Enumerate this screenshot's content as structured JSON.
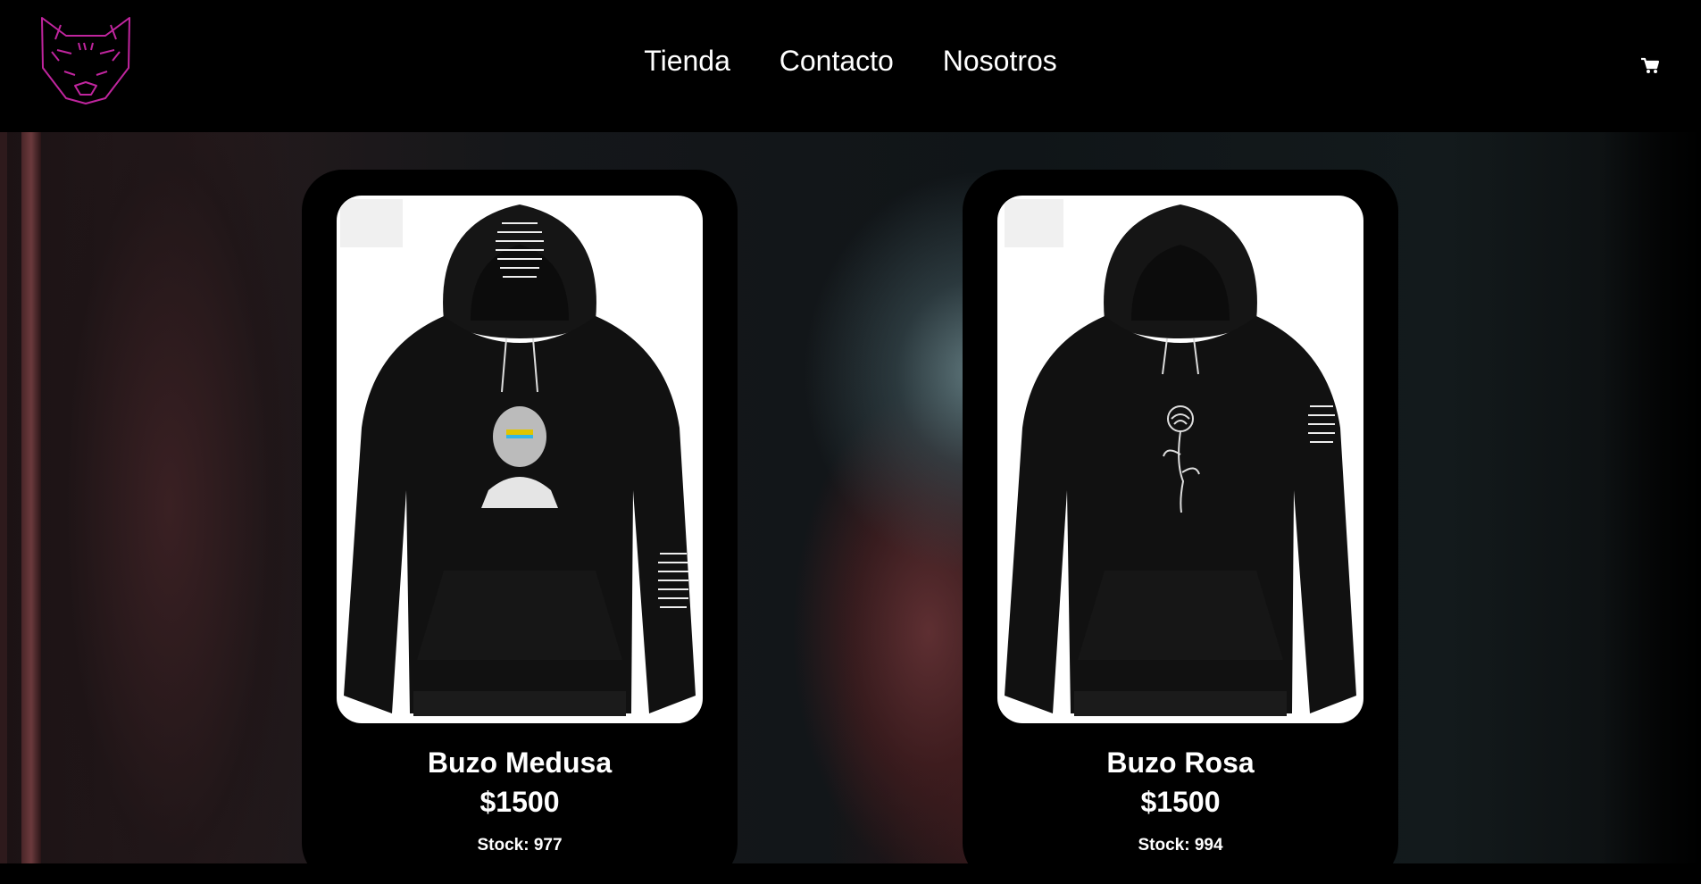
{
  "nav": {
    "logo_icon": "wolf-logo-icon",
    "links": [
      "Tienda",
      "Contacto",
      "Nosotros"
    ],
    "cart_icon": "shopping-cart-icon"
  },
  "colors": {
    "logo": "#c0259e",
    "header_bg": "#000000",
    "card_bg": "#000000",
    "text": "#ffffff"
  },
  "products": [
    {
      "name": "Buzo Medusa",
      "price": "$1500",
      "stock": "Stock: 977",
      "image_icon": "hoodie-medusa-image"
    },
    {
      "name": "Buzo Rosa",
      "price": "$1500",
      "stock": "Stock: 994",
      "image_icon": "hoodie-rose-image"
    }
  ]
}
